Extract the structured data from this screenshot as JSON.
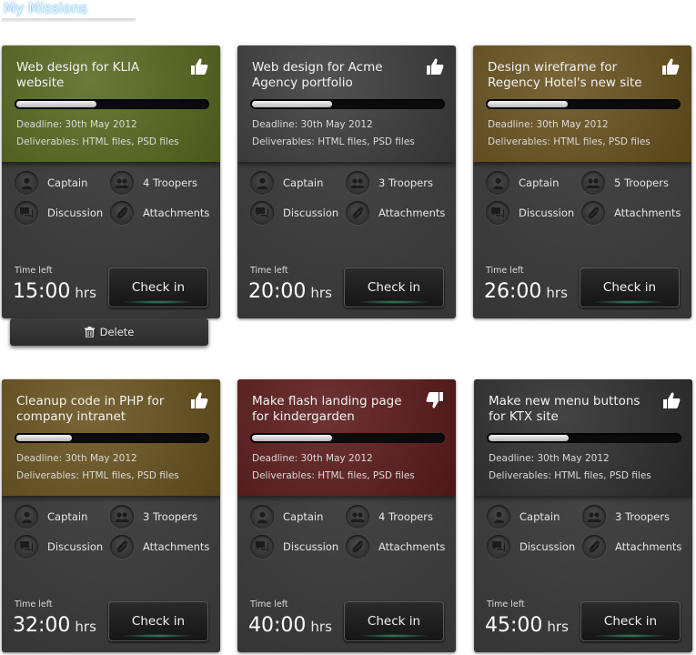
{
  "page": {
    "title": "My Missions"
  },
  "labels": {
    "captain": "Captain",
    "discussion": "Discussion",
    "attachments": "Attachments",
    "time_left": "Time left",
    "hrs": "hrs",
    "check_in": "Check in",
    "delete": "Delete"
  },
  "missions": [
    {
      "title": "Web design for KLIA website",
      "deadline": "Deadline: 30th May 2012",
      "deliverables": "Deliverables: HTML files, PSD files",
      "troopers": "4 Troopers",
      "time": "15:00",
      "progress": 0.42,
      "header_color": "#5a6b22",
      "thumb": "thumbs-up-icon"
    },
    {
      "title": "Web design for Acme Agency portfolio",
      "deadline": "Deadline: 30th May 2012",
      "deliverables": "Deliverables: HTML files, PSD files",
      "troopers": "3 Troopers",
      "time": "20:00",
      "progress": 0.42,
      "header_color": "#3e3e3e",
      "thumb": "thumbs-up-icon"
    },
    {
      "title": "Design wireframe for Regency Hotel's new site",
      "deadline": "Deadline: 30th May 2012",
      "deliverables": "Deliverables: HTML files, PSD files",
      "troopers": "5 Troopers",
      "time": "26:00",
      "progress": 0.42,
      "header_color": "#6a5420",
      "thumb": "thumbs-up-icon"
    },
    {
      "title": "Cleanup code in PHP for company intranet",
      "deadline": "Deadline: 30th May 2012",
      "deliverables": "Deliverables: HTML files, PSD files",
      "troopers": "3 Troopers",
      "time": "32:00",
      "progress": 0.29,
      "header_color": "#6a5420",
      "thumb": "thumbs-up-icon"
    },
    {
      "title": "Make flash landing page for kindergarden",
      "deadline": "Deadline: 30th May 2012",
      "deliverables": "Deliverables: HTML files, PSD files",
      "troopers": "4 Troopers",
      "time": "40:00",
      "progress": 0.42,
      "header_color": "#5e1c1c",
      "thumb": "thumbs-down-icon"
    },
    {
      "title": "Make new menu buttons for KTX site",
      "deadline": "Deadline: 30th May 2012",
      "deliverables": "Deliverables: HTML files, PSD files",
      "troopers": "3 Troopers",
      "time": "45:00",
      "progress": 0.42,
      "header_color": "#2f2f2f",
      "thumb": "thumbs-up-icon"
    }
  ]
}
